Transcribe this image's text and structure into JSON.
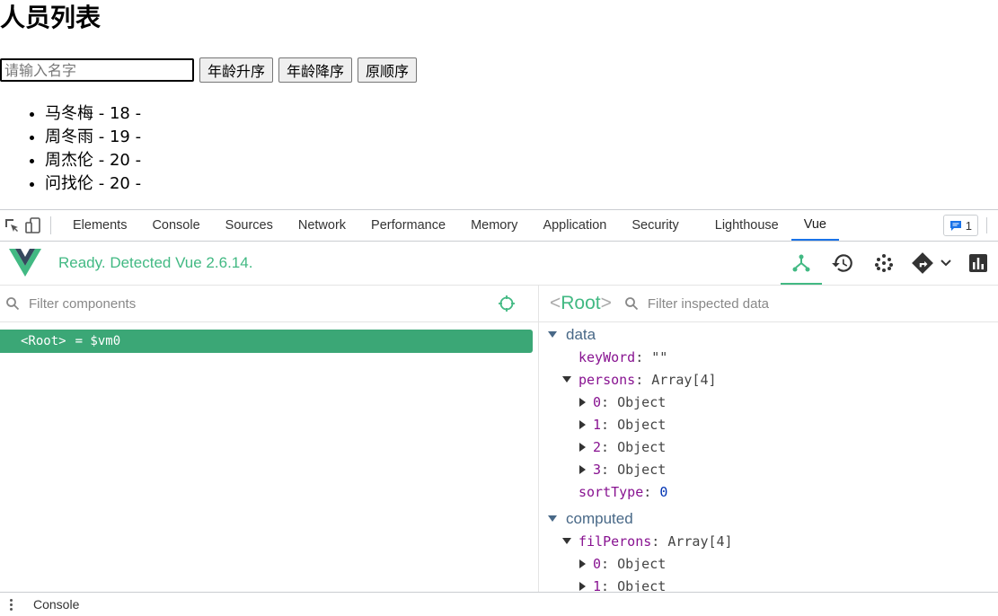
{
  "page": {
    "title": "人员列表",
    "search_placeholder": "请输入名字",
    "buttons": [
      "年龄升序",
      "年龄降序",
      "原顺序"
    ],
    "persons": [
      "马冬梅 - 18 -",
      "周冬雨 - 19 -",
      "周杰伦 - 20 -",
      "问找伦 - 20 -"
    ]
  },
  "devtools": {
    "tabs": [
      "Elements",
      "Console",
      "Sources",
      "Network",
      "Performance",
      "Memory",
      "Application",
      "Security",
      "Lighthouse",
      "Vue"
    ],
    "active_tab": "Vue",
    "issues_count": "1",
    "drawer_label": "Console"
  },
  "vue": {
    "status": "Ready. Detected Vue 2.6.14.",
    "filter_components_placeholder": "Filter components",
    "filter_inspected_placeholder": "Filter inspected data",
    "root_tag": "<Root>",
    "root_ref": "= $vm0",
    "inspected_title": "Root",
    "sections": {
      "data": {
        "label": "data",
        "keyword_key": "keyWord",
        "keyword_val": "\"\"",
        "persons_key": "persons",
        "persons_val": "Array[4]",
        "items": [
          "0",
          "1",
          "2",
          "3"
        ],
        "item_val": "Object",
        "sorttype_key": "sortType",
        "sorttype_val": "0"
      },
      "computed": {
        "label": "computed",
        "filperons_key": "filPerons",
        "filperons_val": "Array[4]",
        "items": [
          "0",
          "1"
        ],
        "item_val": "Object"
      }
    }
  },
  "colors": {
    "vue_green": "#42b983",
    "root_row": "#3ba776",
    "key_purple": "#881391",
    "tab_active": "#1a73e8"
  }
}
